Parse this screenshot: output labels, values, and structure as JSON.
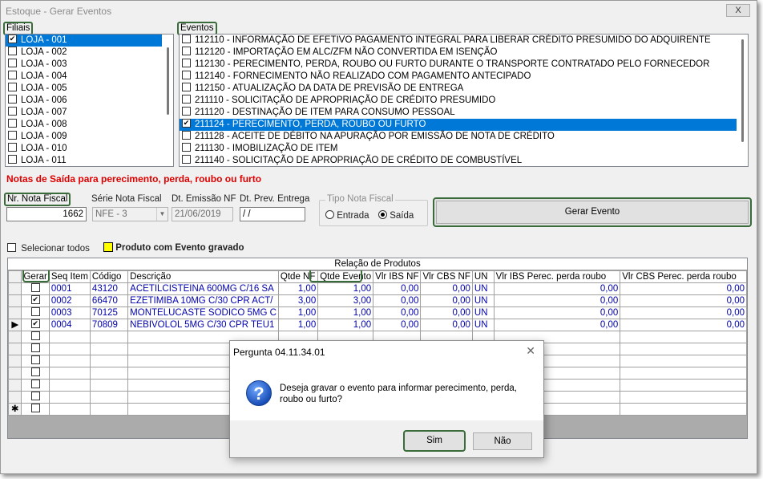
{
  "window": {
    "title": "Estoque - Gerar Eventos",
    "close_label": "X"
  },
  "filiais": {
    "label": "Filiais",
    "items": [
      {
        "label": "LOJA - 001",
        "checked": true
      },
      {
        "label": "LOJA - 002",
        "checked": false
      },
      {
        "label": "LOJA - 003",
        "checked": false
      },
      {
        "label": "LOJA - 004",
        "checked": false
      },
      {
        "label": "LOJA - 005",
        "checked": false
      },
      {
        "label": "LOJA - 006",
        "checked": false
      },
      {
        "label": "LOJA - 007",
        "checked": false
      },
      {
        "label": "LOJA - 008",
        "checked": false
      },
      {
        "label": "LOJA - 009",
        "checked": false
      },
      {
        "label": "LOJA - 010",
        "checked": false
      },
      {
        "label": "LOJA - 011",
        "checked": false
      }
    ]
  },
  "eventos": {
    "label": "Eventos",
    "items": [
      {
        "label": "112110 - INFORMAÇÃO DE EFETIVO PAGAMENTO INTEGRAL PARA LIBERAR CRÉDITO PRESUMIDO DO ADQUIRENTE",
        "checked": false
      },
      {
        "label": "112120 - IMPORTAÇÃO EM ALC/ZFM NÃO CONVERTIDA EM ISENÇÃO",
        "checked": false
      },
      {
        "label": "112130 - PERECIMENTO, PERDA, ROUBO OU FURTO DURANTE O TRANSPORTE CONTRATADO PELO FORNECEDOR",
        "checked": false
      },
      {
        "label": "112140 - FORNECIMENTO NÃO REALIZADO COM PAGAMENTO ANTECIPADO",
        "checked": false
      },
      {
        "label": "112150 - ATUALIZAÇÃO DA DATA DE PREVISÃO DE ENTREGA",
        "checked": false
      },
      {
        "label": "211110 - SOLICITAÇÃO DE APROPRIAÇÃO DE CRÉDITO PRESUMIDO",
        "checked": false
      },
      {
        "label": "211120 - DESTINAÇÃO DE ITEM PARA CONSUMO PESSOAL",
        "checked": false
      },
      {
        "label": "211124 - PERECIMENTO, PERDA, ROUBO OU FURTO",
        "checked": true
      },
      {
        "label": "211128 - ACEITE DE DÉBITO NA APURAÇÃO POR EMISSÃO DE NOTA DE CRÉDITO",
        "checked": false
      },
      {
        "label": "211130 - IMOBILIZAÇÃO DE ITEM",
        "checked": false
      },
      {
        "label": "211140 - SOLICITAÇÃO DE APROPRIAÇÃO DE CRÉDITO DE COMBUSTÍVEL",
        "checked": false
      }
    ]
  },
  "section_title": "Notas de Saída para perecimento, perda, roubo ou furto",
  "form": {
    "nr_nota_label": "Nr. Nota Fiscal",
    "nr_nota_value": "1662",
    "serie_label": "Série Nota Fiscal",
    "serie_value": "NFE - 3",
    "emissao_label": "Dt. Emissão NF",
    "emissao_value": "21/06/2019",
    "prev_entrega_label": "Dt. Prev. Entrega",
    "prev_entrega_value": " /  /",
    "tipo_label": "Tipo Nota Fiscal",
    "entrada_label": "Entrada",
    "saida_label": "Saída",
    "tipo_selected": "Saída",
    "gerar_evento_label": "Gerar Evento"
  },
  "options": {
    "selecionar_todos_label": "Selecionar todos",
    "legend_label": "Produto com Evento gravado",
    "legend_color": "#ffff00"
  },
  "grid": {
    "caption": "Relação de Produtos",
    "headers": [
      "Gerar",
      "Seq Item",
      "Código",
      "Descrição",
      "Qtde NF",
      "Qtde Evento",
      "Vlr IBS NF",
      "Vlr CBS NF",
      "UN",
      "Vlr IBS Perec. perda roubo",
      "Vlr CBS Perec. perda roubo"
    ],
    "rows": [
      {
        "gerar": false,
        "seq": "0001",
        "codigo": "43120",
        "descricao": "ACETILCISTEINA 600MG C/16 SA",
        "qtde_nf": "1,00",
        "qtde_evento": "1,00",
        "ibs_nf": "0,00",
        "cbs_nf": "0,00",
        "un": "UN",
        "ibs_perec": "0,00",
        "cbs_perec": "0,00"
      },
      {
        "gerar": true,
        "seq": "0002",
        "codigo": "66470",
        "descricao": "EZETIMIBA 10MG C/30 CPR ACT/",
        "qtde_nf": "3,00",
        "qtde_evento": "3,00",
        "ibs_nf": "0,00",
        "cbs_nf": "0,00",
        "un": "UN",
        "ibs_perec": "0,00",
        "cbs_perec": "0,00"
      },
      {
        "gerar": false,
        "seq": "0003",
        "codigo": "70125",
        "descricao": "MONTELUCASTE SODICO 5MG C",
        "qtde_nf": "1,00",
        "qtde_evento": "1,00",
        "ibs_nf": "0,00",
        "cbs_nf": "0,00",
        "un": "UN",
        "ibs_perec": "0,00",
        "cbs_perec": "0,00"
      },
      {
        "gerar": true,
        "seq": "0004",
        "codigo": "70809",
        "descricao": "NEBIVOLOL 5MG C/30 CPR TEU1",
        "qtde_nf": "1,00",
        "qtde_evento": "1,00",
        "ibs_nf": "0,00",
        "cbs_nf": "0,00",
        "un": "UN",
        "ibs_perec": "0,00",
        "cbs_perec": "0,00"
      }
    ],
    "current_row_marker": "▶",
    "new_row_marker": "✱"
  },
  "dialog": {
    "title": "Pergunta 04.11.34.01",
    "message": "Deseja gravar o evento para informar perecimento, perda, roubo ou furto?",
    "yes_label": "Sim",
    "no_label": "Não",
    "icon": "question-icon"
  }
}
